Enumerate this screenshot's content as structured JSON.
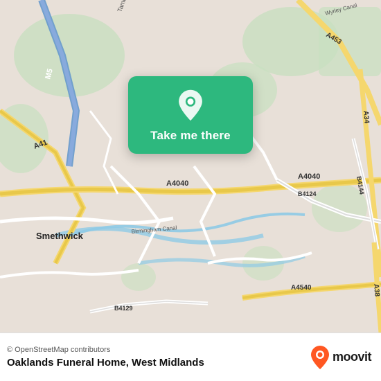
{
  "map": {
    "background_color": "#e8e0d8",
    "alt_text": "Map of West Midlands area showing Smethwick and surrounding roads"
  },
  "card": {
    "button_label": "Take me there",
    "background_color": "#2db87e",
    "pin_icon": "location-pin"
  },
  "bottom_bar": {
    "attribution": "© OpenStreetMap contributors",
    "location_name": "Oaklands Funeral Home, West Midlands",
    "logo_text": "moovit"
  }
}
